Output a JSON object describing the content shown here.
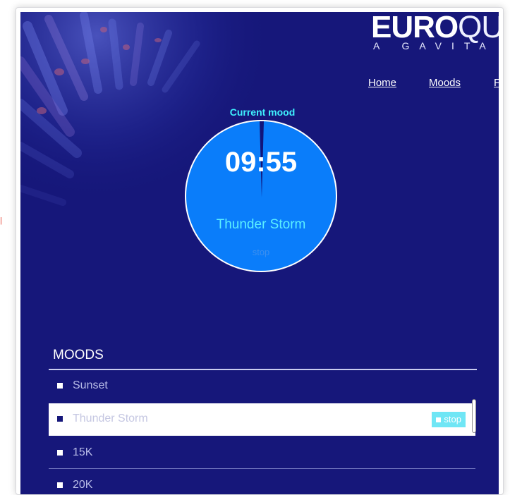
{
  "logo": {
    "bold": "EURO",
    "thin": "QU",
    "tagline": "A GAVITA C"
  },
  "nav": {
    "items": [
      "Home",
      "Moods",
      "F"
    ]
  },
  "current_mood": {
    "heading": "Current mood",
    "time": "09:55",
    "mood": "Thunder Storm",
    "stop_label": "stop"
  },
  "moods": {
    "title": "MOODS",
    "items": [
      {
        "name": "Sunset",
        "active": false
      },
      {
        "name": "Thunder Storm",
        "active": true,
        "stop_label": "stop"
      },
      {
        "name": "15K",
        "active": false
      },
      {
        "name": "20K",
        "active": false
      }
    ]
  },
  "colors": {
    "background": "#16177a",
    "dial": "#0a7dfa",
    "accent_cyan": "#3ff3ff",
    "stop_button": "#6fe6f5"
  }
}
